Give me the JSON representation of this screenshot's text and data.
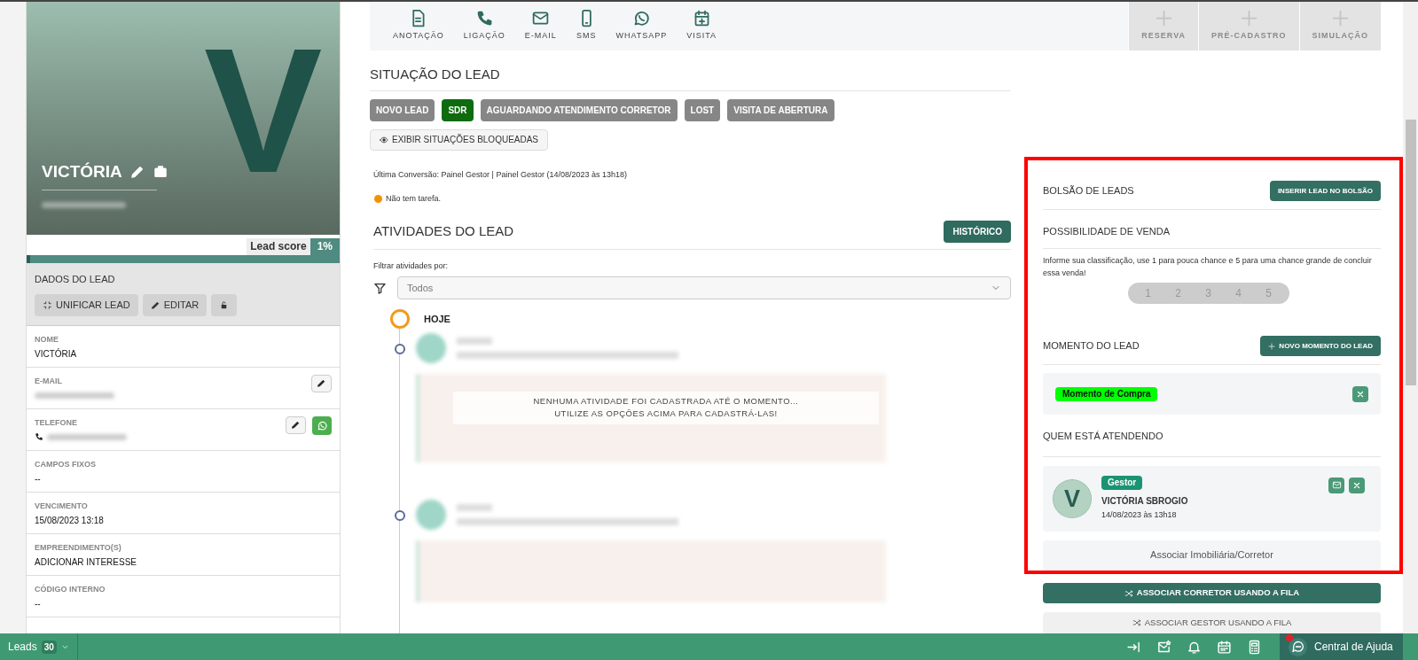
{
  "lead_card": {
    "initial": "V",
    "name": "VICTÓRIA",
    "lead_score_label": "Lead score",
    "lead_score_value": "1%",
    "lead_score": {
      "level": 0.01
    }
  },
  "lead_data": {
    "title": "DADOS DO LEAD",
    "buttons": [
      {
        "kind": "merge",
        "label": "UNIFICAR LEAD"
      },
      {
        "kind": "edit",
        "label": "EDITAR"
      },
      {
        "kind": "lock"
      }
    ],
    "fields": [
      {
        "kind": "text",
        "label": "NOME",
        "value": "VICTÓRIA",
        "editable": false,
        "whatsapp": false
      },
      {
        "kind": "hidden",
        "label": "E-MAIL",
        "editable": true,
        "whatsapp": false
      },
      {
        "kind": "hidden_phone",
        "label": "TELEFONE",
        "editable": true,
        "whatsapp": true
      },
      {
        "kind": "text",
        "label": "CAMPOS FIXOS",
        "value": "--",
        "editable": false,
        "whatsapp": false
      },
      {
        "kind": "text",
        "label": "VENCIMENTO",
        "value": "15/08/2023 13:18",
        "editable": false,
        "whatsapp": false
      },
      {
        "kind": "text",
        "label": "EMPREENDIMENTO(S)",
        "value": "ADICIONAR INTERESSE",
        "editable": false,
        "whatsapp": false
      },
      {
        "kind": "text",
        "label": "CÓDIGO INTERNO",
        "value": "--",
        "editable": false,
        "whatsapp": false
      }
    ]
  },
  "actions_bar": {
    "items": [
      {
        "kind": "note",
        "label": "ANOTAÇÃO",
        "disabled": false
      },
      {
        "kind": "phone",
        "label": "LIGAÇÃO",
        "disabled": false
      },
      {
        "kind": "mail",
        "label": "E-MAIL",
        "disabled": false
      },
      {
        "kind": "sms",
        "label": "SMS",
        "disabled": false
      },
      {
        "kind": "whatsapp",
        "label": "WHATSAPP",
        "disabled": false
      },
      {
        "kind": "visit",
        "label": "VISITA",
        "disabled": false
      },
      {
        "kind": "plus",
        "label": "RESERVA",
        "disabled": true
      },
      {
        "kind": "plus",
        "label": "PRÉ-CADASTRO",
        "disabled": true
      },
      {
        "kind": "plus",
        "label": "SIMULAÇÃO",
        "disabled": true
      }
    ]
  },
  "lead_status": {
    "title": "SITUAÇÃO DO LEAD",
    "statuses": [
      {
        "label": "NOVO LEAD",
        "selected": false
      },
      {
        "label": "SDR",
        "selected": true
      },
      {
        "label": "AGUARDANDO ATENDIMENTO CORRETOR",
        "selected": false
      },
      {
        "label": "LOST",
        "selected": false
      },
      {
        "label": "VISITA DE ABERTURA",
        "selected": false
      }
    ],
    "show_blocked": "EXIBIR SITUAÇÕES BLOQUEADAS",
    "last_conversion": "Última Conversão: Painel Gestor | Painel Gestor (14/08/2023 às 13h18)",
    "task": "Não tem tarefa."
  },
  "activities": {
    "title": "ATIVIDADES DO LEAD",
    "history_button": "HISTÓRICO",
    "filter_label": "Filtrar atividades por:",
    "filter": {
      "value": "Todos"
    },
    "today": "HOJE",
    "empty_message": [
      "NENHUMA ATIVIDADE FOI CADASTRADA ATÉ O MOMENTO...",
      "UTILIZE AS OPÇÕES ACIMA PARA CADASTRÁ-LAS!"
    ]
  },
  "sidebar": {
    "pocket": {
      "title": "BOLSÃO DE LEADS",
      "button": "INSERIR LEAD NO BOLSÃO"
    },
    "sale_chance": {
      "title": "POSSIBILIDADE DE VENDA",
      "description": "Informe sua classificação, use 1 para pouca chance e 5 para uma chance grande de concluir essa venda!",
      "options": [
        {
          "label": "1",
          "selected": false
        },
        {
          "label": "2",
          "selected": false
        },
        {
          "label": "3",
          "selected": false
        },
        {
          "label": "4",
          "selected": false
        },
        {
          "label": "5",
          "selected": false
        }
      ]
    },
    "moment": {
      "title": "MOMENTO DO LEAD",
      "button": "NOVO MOMENTO DO LEAD",
      "tags": [
        {
          "label": "Momento de Compra",
          "color": "#00ff00"
        }
      ]
    },
    "attending": {
      "title": "QUEM ESTÁ ATENDENDO",
      "people": [
        {
          "initial": "V",
          "role": "Gestor",
          "name": "VICTÓRIA SBROGIO",
          "date": "14/08/2023 às 13h18"
        }
      ],
      "associate": "Associar Imobiliária/Corretor"
    },
    "queue_buttons": [
      {
        "label": "ASSOCIAR CORRETOR USANDO A FILA",
        "primary": true
      },
      {
        "label": "ASSOCIAR GESTOR USANDO A FILA",
        "primary": false
      }
    ]
  },
  "status_bar": {
    "leads_label": "Leads",
    "leads_count": "30",
    "help": "Central de Ajuda"
  }
}
